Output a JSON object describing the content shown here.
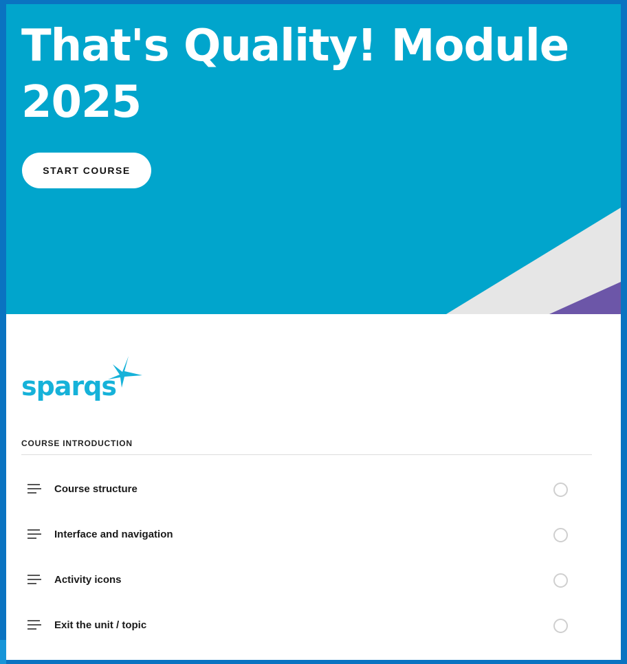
{
  "course": {
    "title": "That's Quality! Module 2025",
    "start_button_label": "START COURSE"
  },
  "brand": {
    "logo_text": "sparqs",
    "colors": {
      "hero_background": "#01a5cc",
      "frame_border": "#0a73c1",
      "logo": "#16b2d9",
      "stripe_white": "#e6e6e6",
      "stripe_purple": "#6c56a8"
    }
  },
  "outline": {
    "section_heading": "COURSE INTRODUCTION",
    "lessons": [
      {
        "label": "Course structure",
        "icon": "text-lines-icon",
        "status": "not-started"
      },
      {
        "label": "Interface and navigation",
        "icon": "text-lines-icon",
        "status": "not-started"
      },
      {
        "label": "Activity icons",
        "icon": "text-lines-icon",
        "status": "not-started"
      },
      {
        "label": "Exit the unit / topic",
        "icon": "text-lines-icon",
        "status": "not-started"
      }
    ]
  }
}
